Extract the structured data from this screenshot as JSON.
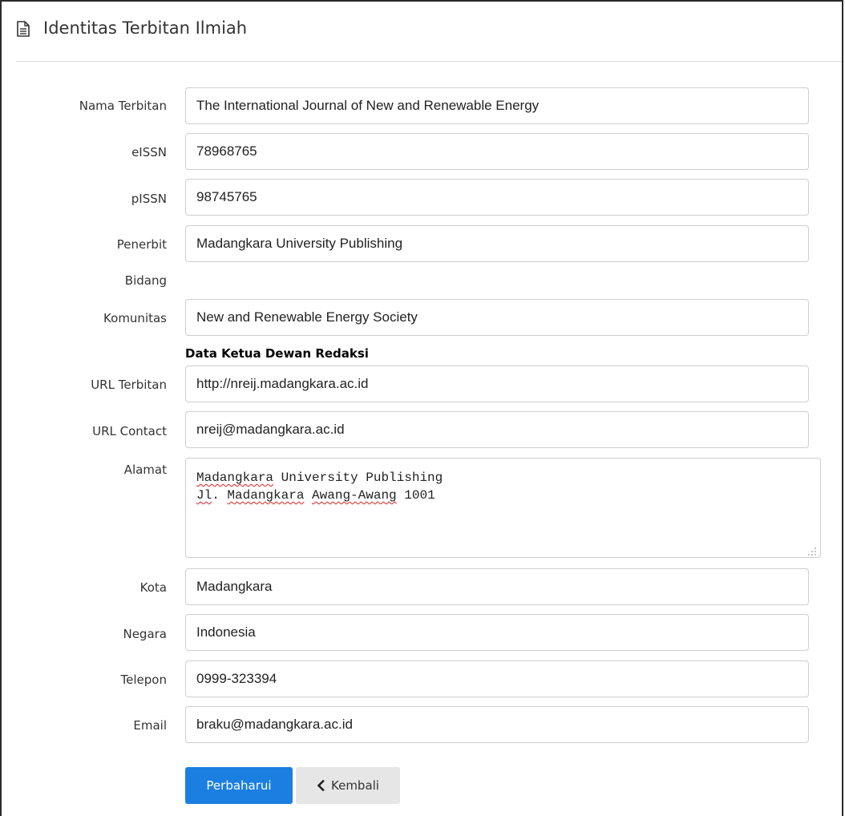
{
  "header": {
    "title": "Identitas Terbitan Ilmiah",
    "icon": "document-icon"
  },
  "form": {
    "nama_terbitan": {
      "label": "Nama Terbitan",
      "value": "The International Journal of New and Renewable Energy"
    },
    "eissn": {
      "label": "eISSN",
      "value": "78968765"
    },
    "pissn": {
      "label": "pISSN",
      "value": "98745765"
    },
    "penerbit": {
      "label": "Penerbit",
      "value": "Madangkara University Publishing"
    },
    "bidang": {
      "label": "Bidang"
    },
    "komunitas": {
      "label": "Komunitas",
      "value": "New and Renewable Energy Society"
    },
    "section_ketua": "Data Ketua Dewan Redaksi",
    "url_terbitan": {
      "label": "URL Terbitan",
      "value": "http://nreij.madangkara.ac.id"
    },
    "url_contact": {
      "label": "URL Contact",
      "value": "nreij@madangkara.ac.id"
    },
    "alamat": {
      "label": "Alamat",
      "line1_a": "Madangkara",
      "line1_b": " University Publishing",
      "line2_a": "Jl",
      "line2_b": ". ",
      "line2_c": "Madangkara",
      "line2_d": " ",
      "line2_e": "Awang-Awang",
      "line2_f": " 1001"
    },
    "kota": {
      "label": "Kota",
      "value": "Madangkara"
    },
    "negara": {
      "label": "Negara",
      "value": "Indonesia"
    },
    "telepon": {
      "label": "Telepon",
      "value": "0999-323394"
    },
    "email": {
      "label": "Email",
      "value": "braku@madangkara.ac.id"
    }
  },
  "actions": {
    "submit_label": "Perbaharui",
    "back_label": "Kembali",
    "back_icon": "chevron-left-icon",
    "primary_color": "#1a7fe0"
  }
}
